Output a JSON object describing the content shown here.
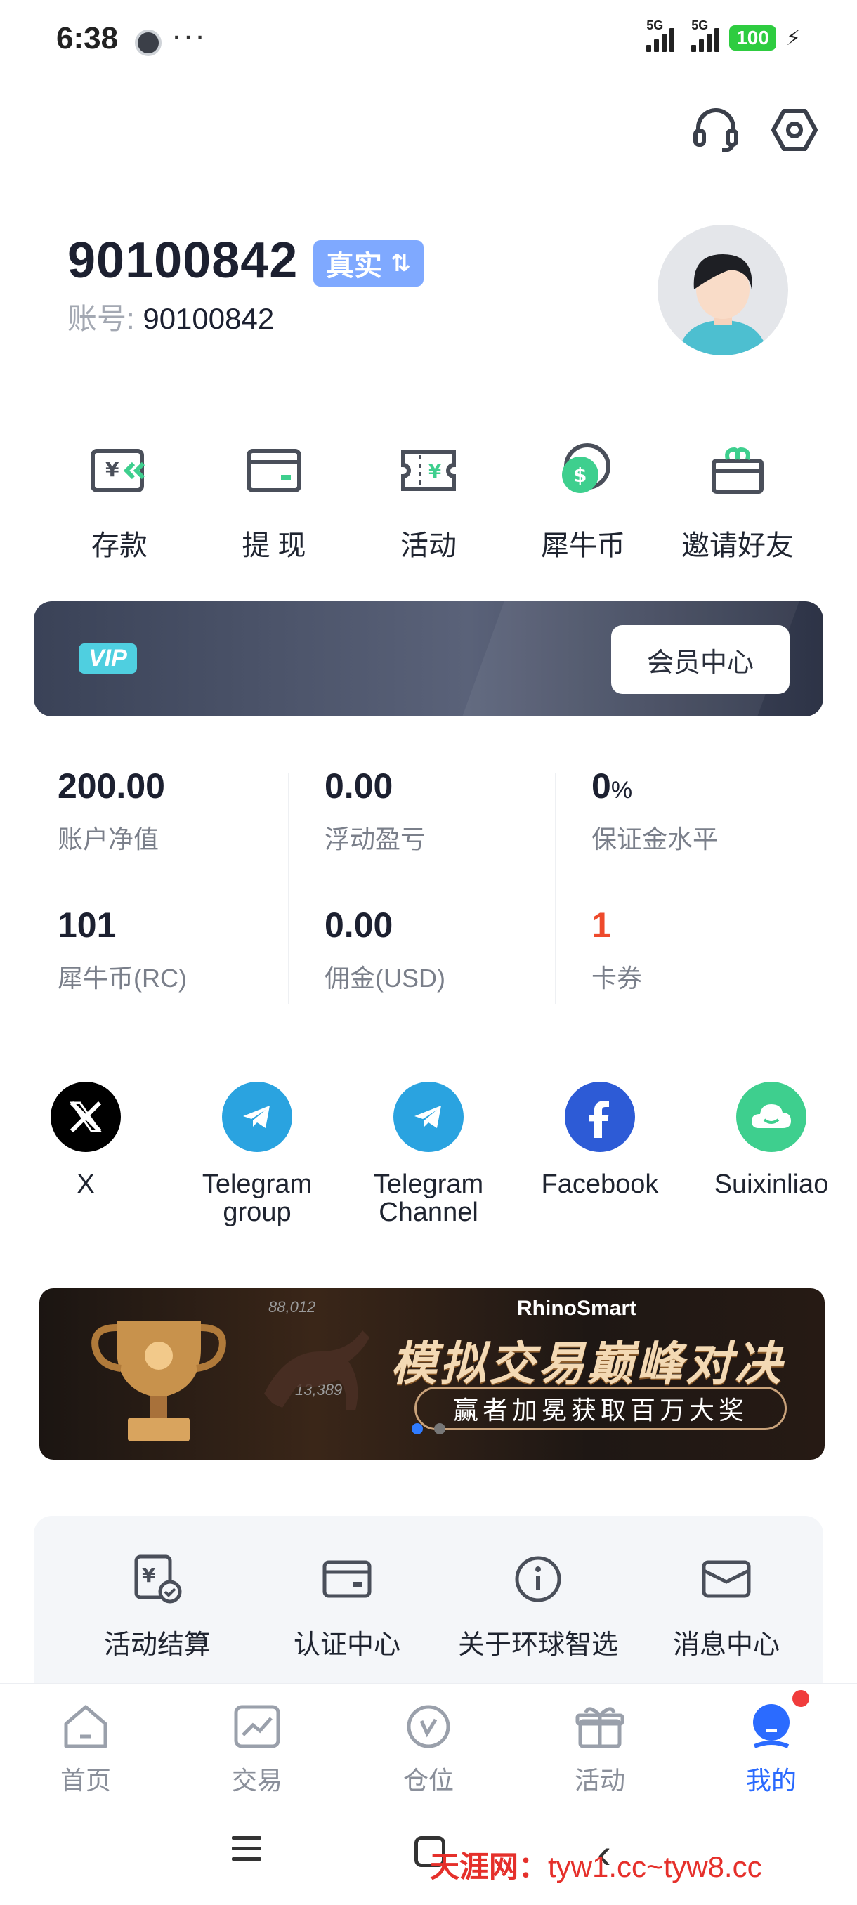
{
  "status_bar": {
    "time": "6:38",
    "more": "···",
    "signal1_label": "5G",
    "signal2_label": "5G",
    "battery": "100",
    "charging_icon": "bolt-icon"
  },
  "top_actions": {
    "support_icon": "headset-icon",
    "settings_icon": "settings-hexagon-icon"
  },
  "profile": {
    "display_id": "90100842",
    "account_type_badge": "真实",
    "account_label": "账号: ",
    "account_number": "90100842"
  },
  "quick_actions": [
    {
      "label": "存款",
      "icon": "deposit-icon"
    },
    {
      "label": "提 现",
      "icon": "withdraw-card-icon"
    },
    {
      "label": "活动",
      "icon": "activity-ticket-icon"
    },
    {
      "label": "犀牛币",
      "icon": "rhino-coin-icon"
    },
    {
      "label": "邀请好友",
      "icon": "gift-icon"
    }
  ],
  "vip": {
    "badge": "VIP",
    "button": "会员中心"
  },
  "stats": [
    {
      "value": "200.00",
      "unit": "",
      "caption": "账户净值"
    },
    {
      "value": "0.00",
      "unit": "",
      "caption": "浮动盈亏"
    },
    {
      "value": "0",
      "unit": "%",
      "caption": "保证金水平"
    },
    {
      "value": "101",
      "unit": "",
      "caption": "犀牛币(RC)"
    },
    {
      "value": "0.00",
      "unit": "",
      "caption": "佣金(USD)"
    },
    {
      "value": "1",
      "unit": "",
      "caption": "卡券",
      "color": "#ee4a2c"
    }
  ],
  "social": [
    {
      "label": "X",
      "icon": "x-logo-icon",
      "color": "#000000"
    },
    {
      "label": "Telegram group",
      "icon": "telegram-icon",
      "color": "#2aa3e0"
    },
    {
      "label": "Telegram Channel",
      "icon": "telegram-icon",
      "color": "#2aa3e0"
    },
    {
      "label": "Facebook",
      "icon": "facebook-icon",
      "color": "#2d5bd6"
    },
    {
      "label": "Suixinliao",
      "icon": "suixinliao-chat-icon",
      "color": "#3ecf8e"
    }
  ],
  "promo": {
    "brand": "RhinoSmart",
    "title": "模拟交易巅峰对决",
    "subtitle": "赢者加冕获取百万大奖",
    "numbers": [
      "88,012",
      "13,389"
    ],
    "active_slide": 1,
    "slide_count": 2
  },
  "menu": [
    {
      "label": "活动结算",
      "icon": "settlement-icon"
    },
    {
      "label": "认证中心",
      "icon": "id-card-icon"
    },
    {
      "label": "关于环球智选",
      "icon": "info-icon"
    },
    {
      "label": "消息中心",
      "icon": "mail-icon"
    }
  ],
  "tabs": [
    {
      "label": "首页",
      "icon": "home-icon"
    },
    {
      "label": "交易",
      "icon": "trade-chart-icon"
    },
    {
      "label": "仓位",
      "icon": "position-icon"
    },
    {
      "label": "活动",
      "icon": "gift-icon"
    },
    {
      "label": "我的",
      "icon": "profile-icon",
      "active": true
    }
  ],
  "watermark": {
    "site": "天涯网：",
    "url": "tyw1.cc~tyw8.cc"
  },
  "colors": {
    "accent": "#2b6bff",
    "badge": "#7fa9ff",
    "icon_green": "#3ecf8e",
    "alert_red": "#ee4a2c"
  }
}
